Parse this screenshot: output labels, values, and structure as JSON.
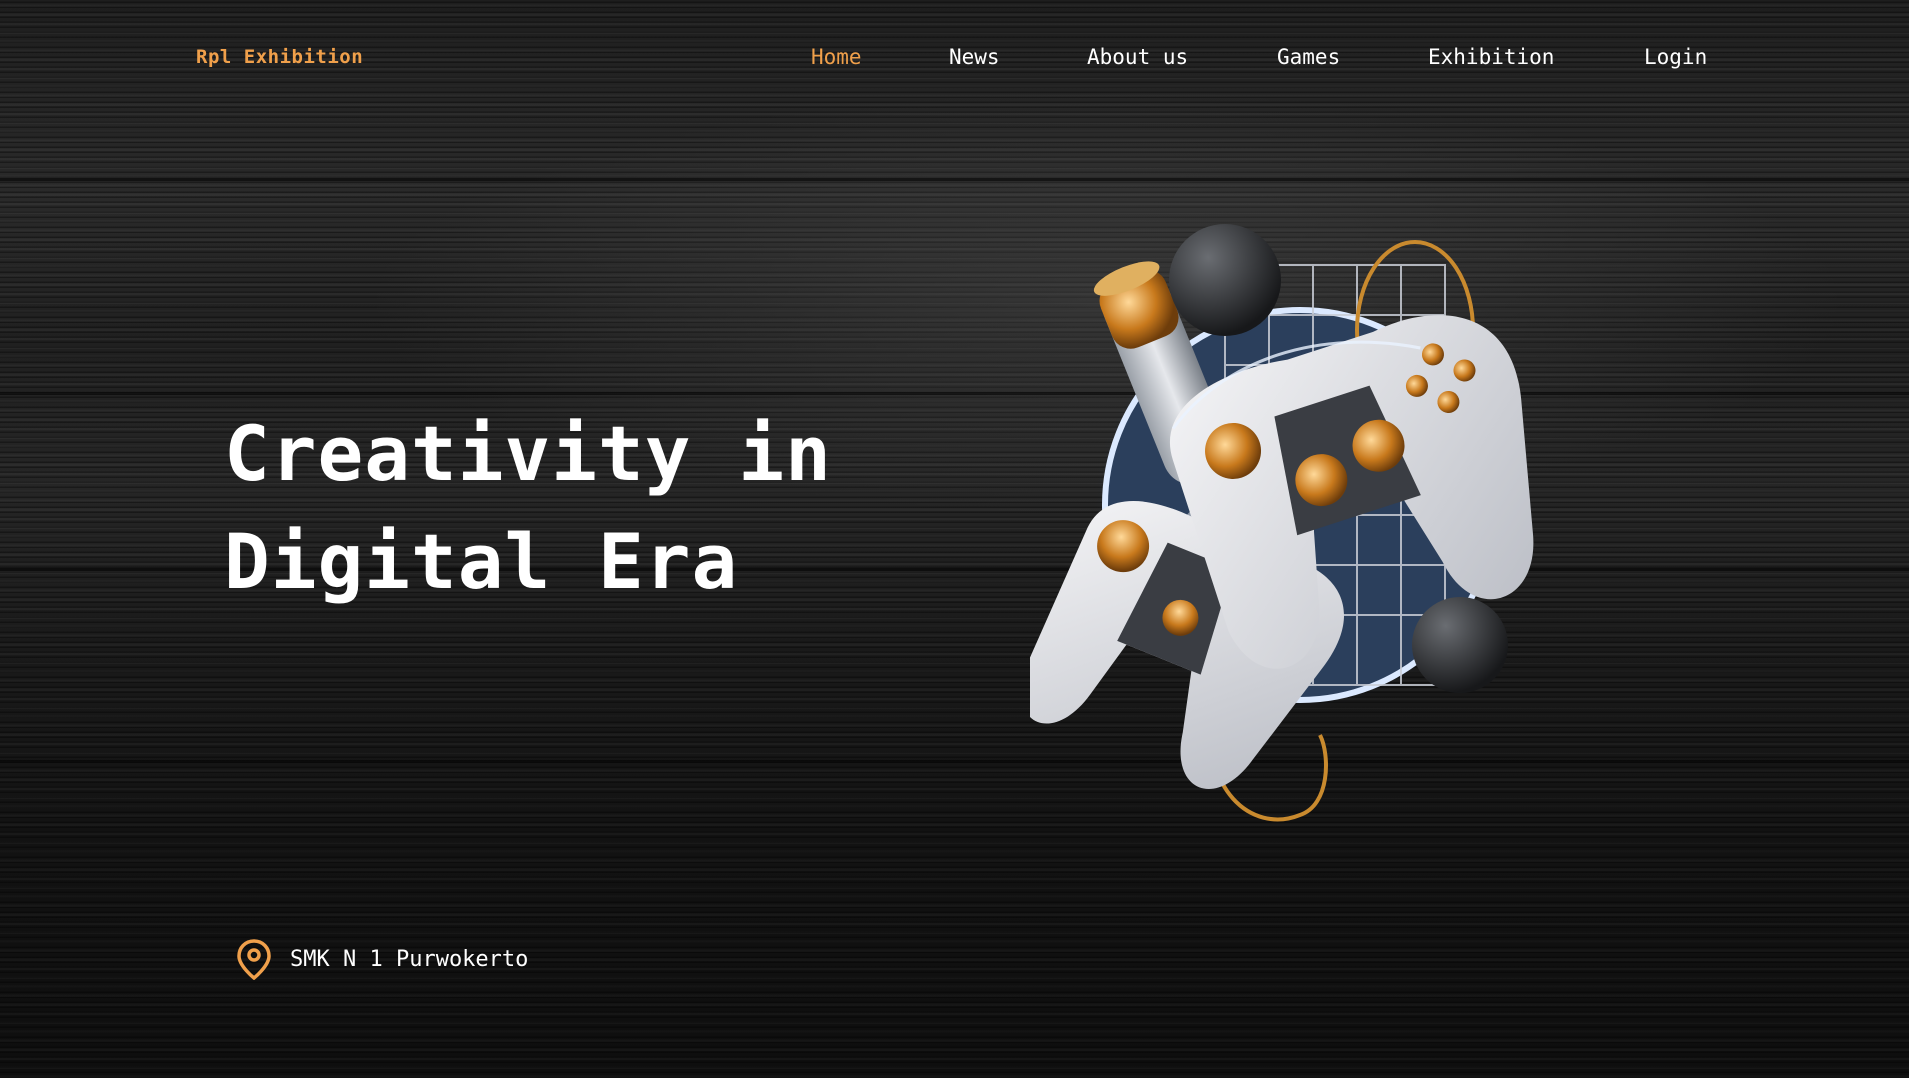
{
  "header": {
    "logo": "Rpl Exhibition",
    "nav": [
      {
        "label": "Home",
        "active": true
      },
      {
        "label": "News",
        "active": false
      },
      {
        "label": "About us",
        "active": false
      },
      {
        "label": "Games",
        "active": false
      },
      {
        "label": "Exhibition",
        "active": false
      },
      {
        "label": "Login",
        "active": false
      }
    ]
  },
  "hero": {
    "title_line1": "Creativity in",
    "title_line2": "Digital Era"
  },
  "location": {
    "icon": "map-pin-icon",
    "text": "SMK N 1 Purwokerto"
  },
  "colors": {
    "accent": "#f0a04b",
    "background": "#0d0d0d",
    "text": "#ffffff"
  }
}
